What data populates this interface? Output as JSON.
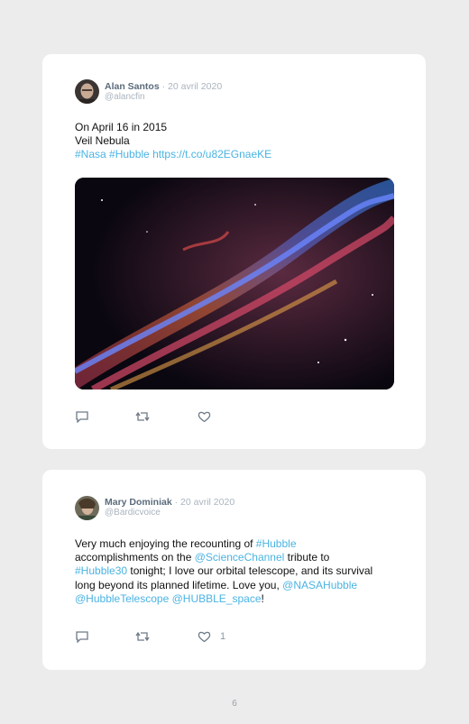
{
  "tweets": [
    {
      "name": "Alan Santos",
      "separator": "·",
      "date": "20 avril 2020",
      "handle": "@alancfin",
      "lines": [
        "On April 16 in 2015",
        "Veil Nebula"
      ],
      "tags": [
        "#Nasa",
        "#Hubble"
      ],
      "url": "https://t.co/u82EGnaeKE",
      "image_alt": "Veil Nebula image"
    },
    {
      "name": "Mary Dominiak",
      "separator": "·",
      "date": "20 avril 2020",
      "handle": "@Bardicvoice",
      "body": {
        "t1": "Very much enjoying the recounting of ",
        "l1": "#Hubble",
        "t2": "accomplishments on the ",
        "l2": "@ScienceChannel",
        "t3": " tribute to",
        "l3": "#Hubble30",
        "t4": " tonight; I love our orbital telescope, and its survival long beyond its planned lifetime. Love you,",
        "l4": "@NASAHubble",
        "l5": "@HubbleTelescope",
        "l6": "@HUBBLE_space",
        "t5": "!"
      },
      "like_count": "1"
    }
  ],
  "page_number": "6",
  "colors": {
    "link": "#4ab3e2",
    "name": "#5a6b7b",
    "muted": "#aab4bf"
  },
  "icons": [
    "reply-icon",
    "retweet-icon",
    "like-icon"
  ]
}
